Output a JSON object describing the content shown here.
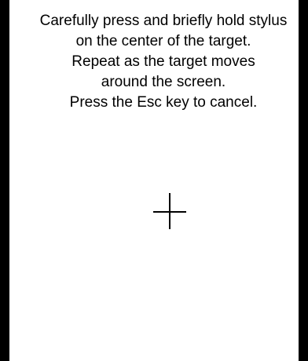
{
  "calibration": {
    "instructions": [
      "Carefully press and briefly hold stylus",
      "on the center of the target.",
      "Repeat as the target moves",
      "around the screen.",
      "Press the Esc key to cancel."
    ],
    "target_icon": "crosshair-target-icon",
    "colors": {
      "background": "#ffffff",
      "foreground": "#000000",
      "frame": "#000000"
    }
  }
}
